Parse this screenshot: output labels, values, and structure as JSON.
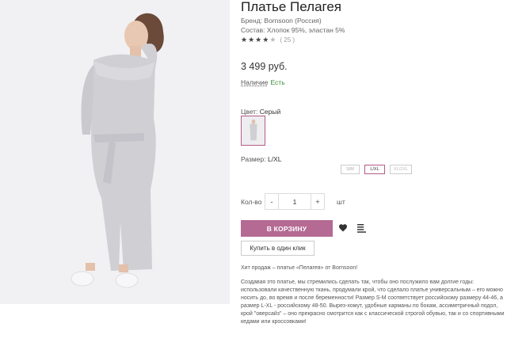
{
  "product": {
    "title": "Платье Пелагея",
    "brand": "Бренд: Bornsoon (Россия)",
    "composition": "Состав: Хлопок 95%, эластан 5%",
    "rating": 4,
    "reviews": "( 25 )",
    "price": "3 499 руб."
  },
  "availability": {
    "label": "Наличие",
    "value": "Есть"
  },
  "color": {
    "label": "Цвет:",
    "value": "Серый",
    "swatch_color": "#d8d8dc"
  },
  "size": {
    "label": "Размер:",
    "value": "L/XL",
    "options": [
      {
        "label": "S/M",
        "state": "na"
      },
      {
        "label": "L/XL",
        "state": "selected"
      },
      {
        "label": "XL/2XL",
        "state": "available"
      }
    ]
  },
  "quantity": {
    "label": "Кол-во",
    "minus": "-",
    "value": "1",
    "plus": "+",
    "unit": "шт"
  },
  "actions": {
    "add_to_cart": "В КОРЗИНУ",
    "buy_one_click": "Купить в один клик",
    "accent_color": "#b46a93",
    "favorite_icon": "heart-icon",
    "compare_icon": "compare-icon"
  },
  "description": {
    "intro": "Хит продаж – платье «Пелагея» от Bornsoon!",
    "body": "Создавая это платье, мы стремились сделать так, чтобы оно послужило вам долгие годы: использовали качественную ткань, продумали крой, что сделало платье универсальным – его можно носить до, во время и после беременности! Размер S-M соответствует российскому размеру 44-46, а размер L-XL - российскому 48-50. Вырез-хомут, удобные карманы по бокам, ассиметричный подол, крой \"оверсайз\" – оно прекрасно смотрится как с классической строгой обувью, так и со спортивными кедами или кроссовками!"
  }
}
